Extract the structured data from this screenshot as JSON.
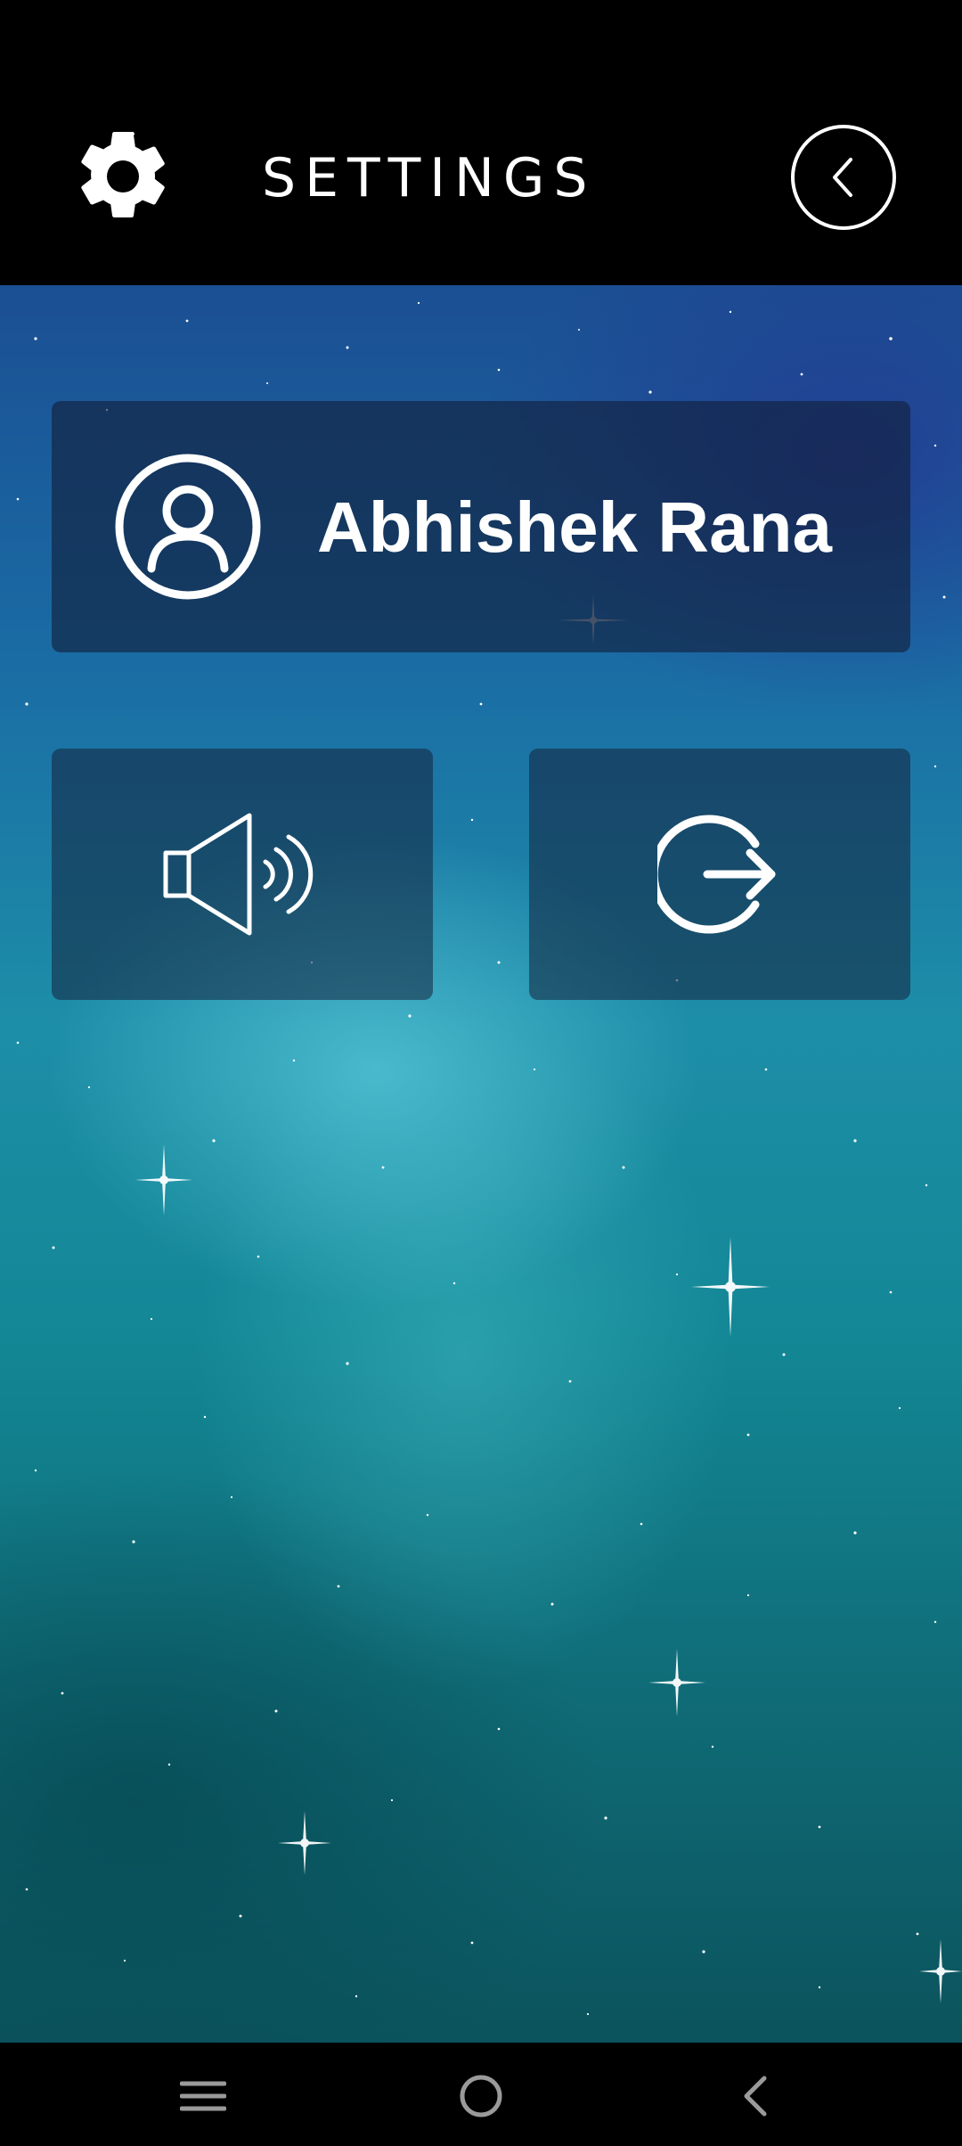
{
  "header": {
    "title": "SETTINGS",
    "settings_icon": "gear-icon",
    "back_icon": "chevron-left-circle-icon"
  },
  "profile": {
    "name": "Abhishek Rana",
    "avatar_icon": "user-circle-icon"
  },
  "tiles": {
    "sound_icon": "speaker-volume-icon",
    "logout_icon": "logout-arrow-icon"
  },
  "navbar": {
    "recents_icon": "menu-lines-icon",
    "home_icon": "home-circle-icon",
    "back_icon": "back-chevron-icon"
  },
  "colors": {
    "header_bg": "#000000",
    "text": "#ffffff",
    "card_bg": "rgba(20,35,60,0.55)"
  }
}
